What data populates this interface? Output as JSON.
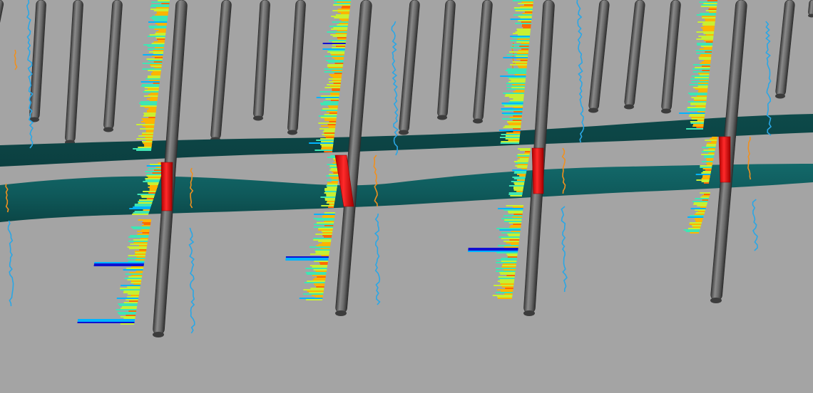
{
  "viewport": {
    "background_color": "#a4a4a4"
  },
  "colors": {
    "well_body": "#6e6e6e",
    "well_edge": "#2f2f2f",
    "horizon_top": "#0f4d4d",
    "horizon_bottom": "#115c5c",
    "reservoir_marker": "#ff1a1a",
    "side_log_blue": "#2aa7e6",
    "side_log_orange": "#f0901e",
    "log_colormap": [
      "#1010d0",
      "#00b4ff",
      "#3ee6b4",
      "#c8f032",
      "#ffb400",
      "#ff6a00"
    ]
  },
  "icons": {
    "well": "vertical-cylinder",
    "log_track": "colored-bar-log",
    "horizon": "surface-band"
  }
}
